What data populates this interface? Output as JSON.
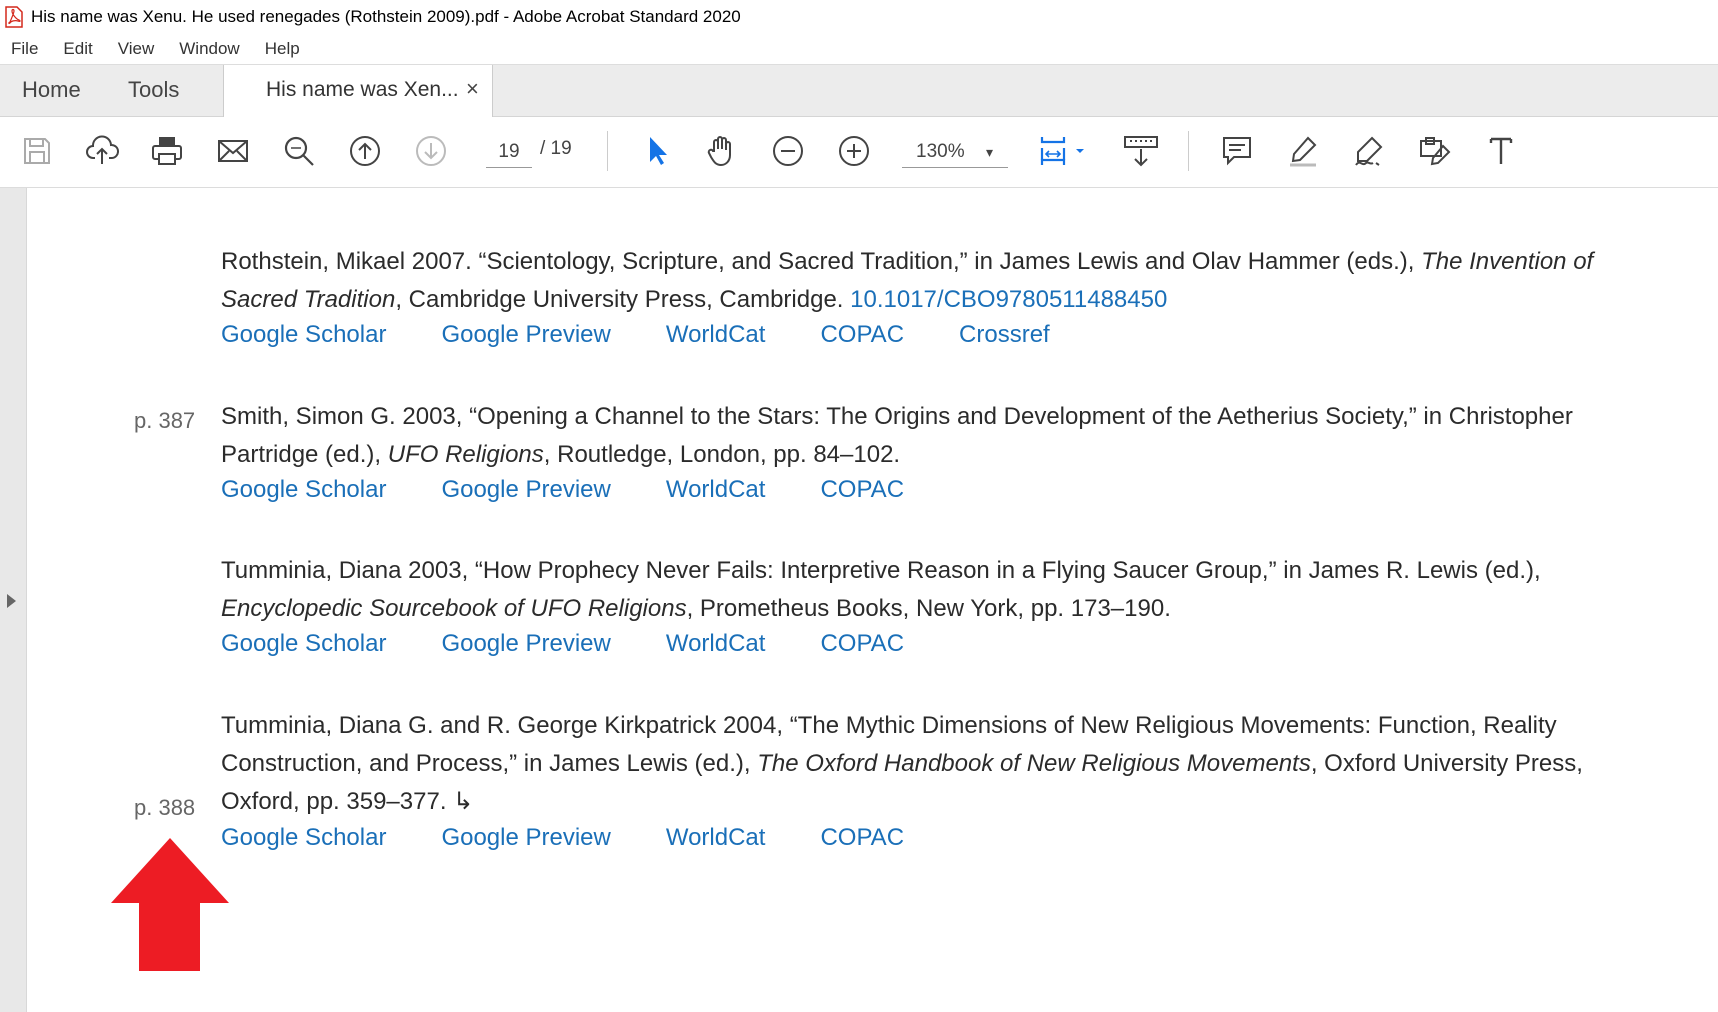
{
  "window": {
    "title": "His name was Xenu. He used renegades (Rothstein 2009).pdf - Adobe Acrobat Standard 2020"
  },
  "menu": [
    "File",
    "Edit",
    "View",
    "Window",
    "Help"
  ],
  "tabs": {
    "home": "Home",
    "tools": "Tools",
    "doc": "His name was Xen...",
    "close": "×"
  },
  "toolbar": {
    "page_current": "19",
    "page_total": "/ 19",
    "zoom": "130%",
    "zoom_arrow": "▾"
  },
  "references": [
    {
      "text_a": "Rothstein, Mikael  2007. “Scientology, Scripture, and Sacred Tradition,” in James Lewis and Olav Hammer (eds.), ",
      "italic": "The Invention of Sacred Tradition",
      "text_b": ", Cambridge University Press, Cambridge.  ",
      "doi": "10.1017/CBO9780511488450",
      "links": [
        "Google Scholar",
        "Google Preview",
        "WorldCat",
        "COPAC",
        "Crossref"
      ]
    },
    {
      "page": "p. 387",
      "text_a": " Smith, Simon G.  2003, “Opening a Channel to the Stars: The Origins and Development of the Aetherius Society,” in Christopher Partridge (ed.), ",
      "italic": "UFO Religions",
      "text_b": ", Routledge, London, pp. 84–102.",
      "links": [
        "Google Scholar",
        "Google Preview",
        "WorldCat",
        "COPAC"
      ]
    },
    {
      "text_a": "Tumminia, Diana  2003, “How Prophecy Never Fails: Interpretive Reason in a Flying Saucer Group,” in James R. Lewis (ed.), ",
      "italic": "Encyclopedic Sourcebook of UFO Religions",
      "text_b": ", Prometheus Books, New York, pp. 173–190.",
      "links": [
        "Google Scholar",
        "Google Preview",
        "WorldCat",
        "COPAC"
      ]
    },
    {
      "page": "p. 388",
      "text_a": "Tumminia, Diana G. and R. George Kirkpatrick  2004, “The Mythic Dimensions of New Religious Movements: Function, Reality Construction, and Process,” in James Lewis (ed.), ",
      "italic": "The Oxford Handbook of New Religious Movements",
      "text_b": ", Oxford University Press, Oxford, pp. 359–377. ↳",
      "links": [
        "Google Scholar",
        "Google Preview",
        "WorldCat",
        "COPAC"
      ]
    }
  ],
  "colors": {
    "link": "#1a6fb8",
    "arrow": "#ed1c24",
    "accent": "#1473e6"
  }
}
